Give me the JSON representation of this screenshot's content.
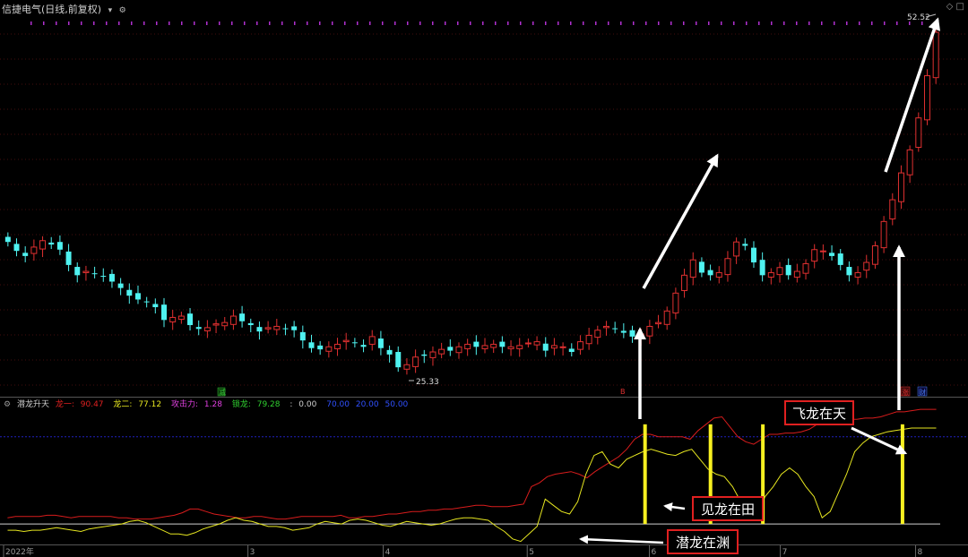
{
  "header": {
    "title": "信捷电气(日线,前复权)",
    "collapse_glyph": "▾",
    "settings_glyph": "⚙",
    "right_glyphs": "◇ □"
  },
  "price_labels": {
    "high": "52.52",
    "low": "25.33"
  },
  "markers": [
    {
      "text": "减",
      "color": "#36c236"
    },
    {
      "text": "B",
      "color": "#e03030"
    },
    {
      "text": "涨",
      "color": "#e03030"
    },
    {
      "text": "财",
      "color": "#4a7cf0"
    }
  ],
  "indicator": {
    "name": "潜龙升天",
    "items": [
      {
        "label": "龙一:",
        "value": "90.47",
        "color": "#e02020"
      },
      {
        "label": "龙二:",
        "value": "77.12",
        "color": "#e8e820"
      },
      {
        "label": "攻击力:",
        "value": "1.28",
        "color": "#e040e0"
      },
      {
        "label": "锁龙:",
        "value": "79.28",
        "color": "#30d030"
      },
      {
        "label": ":",
        "value": "0.00",
        "color": "#d0d0d0"
      },
      {
        "label": "",
        "value": "70.00",
        "color": "#3050ff"
      },
      {
        "label": "",
        "value": "20.00",
        "color": "#3050ff"
      },
      {
        "label": "",
        "value": "50.00",
        "color": "#3050ff"
      }
    ],
    "gear_glyph": "⚙"
  },
  "annotations": [
    "飞龙在天",
    "见龙在田",
    "潜龙在渊"
  ],
  "x_axis": {
    "labels": [
      "2022年",
      "3",
      "4",
      "5",
      "6",
      "7",
      "8"
    ]
  },
  "colors": {
    "up": "#e03030",
    "down": "#4ff2f0",
    "line1": "#d81c1c",
    "line2": "#e6e620",
    "signal": "#f7f020",
    "grid": "#8a1c1c",
    "ref": "#2020c0",
    "annotation_border": "#e02020"
  },
  "chart_data": [
    {
      "type": "candlestick",
      "title": "信捷电气(日线,前复权)",
      "note": "approximate daily closes read from the chart, one value per trading session",
      "closes": [
        35.2,
        34.5,
        34.1,
        34.8,
        35.3,
        35.0,
        34.6,
        33.4,
        32.6,
        32.9,
        32.7,
        32.5,
        32.1,
        31.6,
        31.0,
        30.7,
        30.5,
        30.1,
        29.1,
        29.3,
        29.4,
        28.7,
        28.4,
        28.5,
        28.8,
        28.9,
        29.4,
        29.0,
        28.7,
        28.2,
        28.5,
        28.6,
        28.4,
        28.3,
        27.5,
        26.9,
        26.8,
        27.0,
        27.2,
        27.5,
        27.3,
        27.0,
        27.8,
        26.9,
        26.4,
        25.4,
        25.6,
        26.2,
        26.3,
        26.6,
        26.8,
        26.7,
        27.0,
        27.2,
        27.0,
        27.1,
        27.2,
        27.0,
        27.0,
        27.1,
        27.3,
        27.4,
        26.7,
        27.1,
        27.0,
        26.6,
        27.4,
        27.9,
        28.3,
        28.6,
        28.4,
        28.1,
        27.8,
        28.0,
        28.6,
        28.9,
        29.8,
        31.2,
        32.6,
        33.8,
        32.8,
        32.6,
        32.8,
        33.9,
        35.2,
        34.9,
        33.6,
        32.6,
        32.8,
        33.2,
        32.6,
        32.9,
        33.5,
        34.6,
        34.5,
        34.1,
        33.4,
        32.6,
        32.8,
        33.6,
        34.9,
        36.8,
        38.5,
        40.6,
        42.4,
        44.9,
        48.2,
        51.6
      ]
    },
    {
      "type": "line",
      "title": "潜龙升天",
      "series": [
        {
          "name": "龙一",
          "values": [
            5,
            6,
            6,
            6,
            6,
            7,
            7,
            6,
            5,
            6,
            6,
            6,
            6,
            6,
            5,
            5,
            4,
            4,
            4,
            5,
            6,
            7,
            9,
            12,
            12,
            10,
            8,
            7,
            6,
            5,
            5,
            6,
            6,
            5,
            4,
            4,
            5,
            6,
            6,
            6,
            6,
            6,
            7,
            5,
            5,
            6,
            6,
            7,
            8,
            8,
            9,
            10,
            10,
            11,
            11,
            12,
            12,
            13,
            14,
            15,
            15,
            14,
            14,
            14,
            15,
            16,
            30,
            33,
            38,
            40,
            41,
            42,
            40,
            37,
            42,
            46,
            50,
            54,
            60,
            68,
            72,
            72,
            70,
            70,
            70,
            70,
            68,
            75,
            80,
            85,
            86,
            78,
            70,
            66,
            64,
            68,
            72,
            72,
            73,
            73,
            74,
            76,
            80,
            82,
            86,
            85,
            84,
            84,
            85,
            85,
            86,
            88,
            90,
            90,
            91,
            92,
            92,
            92
          ]
        },
        {
          "name": "龙二",
          "values": [
            -5,
            -5,
            -6,
            -5,
            -5,
            -4,
            -3,
            -4,
            -5,
            -6,
            -4,
            -3,
            -2,
            -1,
            0,
            2,
            3,
            1,
            -2,
            -5,
            -8,
            -8,
            -9,
            -7,
            -4,
            -2,
            0,
            3,
            5,
            3,
            2,
            0,
            -2,
            -2,
            -3,
            -5,
            -4,
            -3,
            0,
            2,
            1,
            0,
            3,
            4,
            3,
            1,
            -1,
            -2,
            0,
            2,
            1,
            0,
            -1,
            0,
            2,
            4,
            5,
            5,
            4,
            3,
            -2,
            -6,
            -12,
            -14,
            -8,
            -2,
            20,
            15,
            10,
            8,
            18,
            40,
            55,
            58,
            48,
            45,
            52,
            55,
            58,
            60,
            58,
            56,
            55,
            58,
            60,
            52,
            44,
            40,
            38,
            30,
            18,
            10,
            8,
            22,
            30,
            40,
            45,
            40,
            30,
            22,
            5,
            10,
            25,
            40,
            58,
            65,
            70,
            72,
            74,
            75,
            76,
            77,
            77,
            77,
            77
          ]
        }
      ],
      "reference_lines": [
        0,
        20,
        50,
        70
      ],
      "signal_bars": [
        "2022-05-31",
        "2022-06-15",
        "2022-06-27",
        "2022-07-29"
      ]
    }
  ]
}
